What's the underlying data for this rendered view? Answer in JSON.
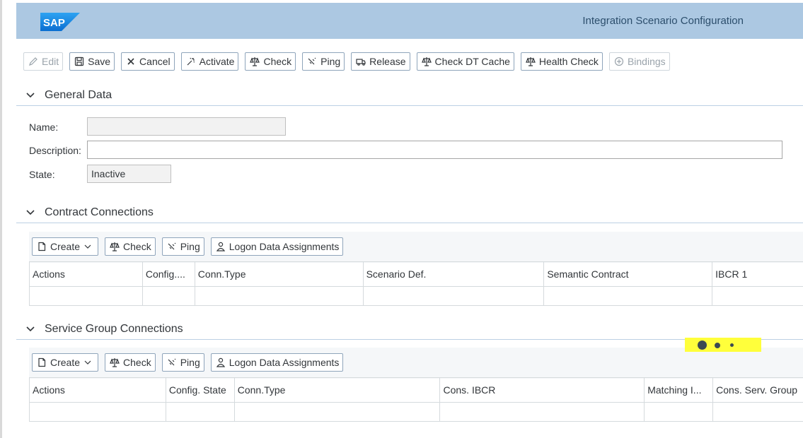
{
  "header": {
    "logo_text": "SAP",
    "title": "Integration Scenario Configuration"
  },
  "toolbar": [
    {
      "label": "Edit",
      "icon": "pencil-icon",
      "disabled": true
    },
    {
      "label": "Save",
      "icon": "save-icon",
      "disabled": false
    },
    {
      "label": "Cancel",
      "icon": "close-icon",
      "disabled": false
    },
    {
      "label": "Activate",
      "icon": "activate-icon",
      "disabled": false
    },
    {
      "label": "Check",
      "icon": "check-icon",
      "disabled": false
    },
    {
      "label": "Ping",
      "icon": "ping-icon",
      "disabled": false
    },
    {
      "label": "Release",
      "icon": "release-icon",
      "disabled": false
    },
    {
      "label": "Check DT Cache",
      "icon": "check-icon",
      "disabled": false
    },
    {
      "label": "Health Check",
      "icon": "check-icon",
      "disabled": false
    },
    {
      "label": "Bindings",
      "icon": "bindings-icon",
      "disabled": true
    }
  ],
  "general": {
    "title": "General Data",
    "name_label": "Name:",
    "name_value": "",
    "description_label": "Description:",
    "description_value": "",
    "state_label": "State:",
    "state_value": "Inactive"
  },
  "contract": {
    "title": "Contract Connections",
    "buttons": {
      "create": "Create",
      "check": "Check",
      "ping": "Ping",
      "logon": "Logon Data Assignments"
    },
    "columns": [
      "Actions",
      "Config....",
      "Conn.Type",
      "Scenario Def.",
      "Semantic Contract",
      "IBCR 1"
    ]
  },
  "service": {
    "title": "Service Group Connections",
    "buttons": {
      "create": "Create",
      "check": "Check",
      "ping": "Ping",
      "logon": "Logon Data Assignments"
    },
    "columns": [
      "Actions",
      "Config. State",
      "Conn.Type",
      "Cons. IBCR",
      "Matching I...",
      "Cons. Serv. Group"
    ]
  },
  "colors": {
    "header_bg": "#acc8e2",
    "busy_highlight": "#ffff3b",
    "brand_blue": "#1a73c7"
  }
}
